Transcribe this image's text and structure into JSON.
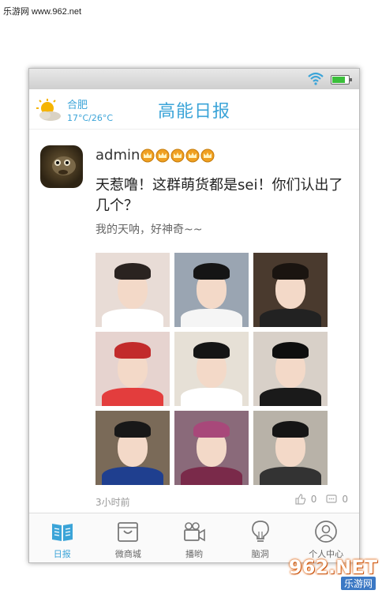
{
  "watermark": {
    "site": "乐游网 www.962.net"
  },
  "status_bar": {
    "battery_level": 0.8
  },
  "header": {
    "weather_icon": "sun-cloud-icon",
    "city": "合肥",
    "temperature": "17°C/26°C",
    "title": "高能日报"
  },
  "post": {
    "author_name": "admin",
    "badge_icon": "crown-icon",
    "badge_count": 5,
    "text": "天惹噜！这群萌货都是sei！你们认出了几个？",
    "subtext": "我的天呐，好神奇~~",
    "photos": [
      {
        "bg": "#e8dcd6",
        "hair": "#2a2320",
        "body": "#ffffff"
      },
      {
        "bg": "#9aa5b2",
        "hair": "#151515",
        "body": "#f5f5f5"
      },
      {
        "bg": "#4a3a2e",
        "hair": "#1a1410",
        "body": "#222222"
      },
      {
        "bg": "#e6d3cf",
        "hair": "#c22b2b",
        "body": "#e33d3d"
      },
      {
        "bg": "#e6e0d6",
        "hair": "#151515",
        "body": "#ffffff"
      },
      {
        "bg": "#d8d0c8",
        "hair": "#0e0e0e",
        "body": "#1a1a1a"
      },
      {
        "bg": "#7a6a58",
        "hair": "#181818",
        "body": "#1f3f8f"
      },
      {
        "bg": "#8a6a7a",
        "hair": "#a8487a",
        "body": "#7a2a4a"
      },
      {
        "bg": "#b8b2a8",
        "hair": "#151515",
        "body": "#333333"
      }
    ],
    "time": "3小时前",
    "like_count": "0",
    "comment_count": "0",
    "like_icon": "thumbs-up-icon",
    "comment_icon": "comment-icon"
  },
  "tabbar": {
    "active_color": "#3ba4d8",
    "items": [
      {
        "label": "日报",
        "icon": "book-icon"
      },
      {
        "label": "微商城",
        "icon": "shopping-bag-icon"
      },
      {
        "label": "播哟",
        "icon": "video-camera-icon"
      },
      {
        "label": "脑洞",
        "icon": "lightbulb-icon"
      },
      {
        "label": "个人中心",
        "icon": "user-icon"
      }
    ]
  },
  "watermark_logo": {
    "top": "962.NET",
    "bottom": "乐游网"
  }
}
